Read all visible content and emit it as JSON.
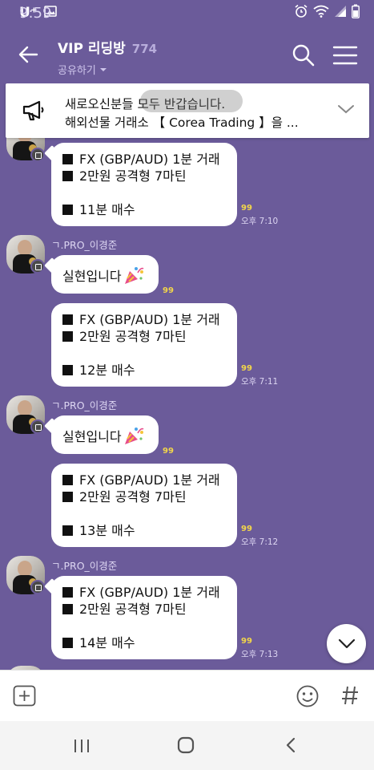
{
  "status_bar": {
    "carrier": "U⁺",
    "time": "9:59",
    "icons": [
      "image-icon",
      "alarm-icon",
      "wifi-icon",
      "signal-icon",
      "battery-icon"
    ]
  },
  "header": {
    "title": "VIP 리딩방",
    "member_count": "774",
    "subtitle": "공유하기",
    "icons": [
      "back-arrow-icon",
      "search-icon",
      "menu-icon"
    ]
  },
  "notice": {
    "line1": "새로오신분들 모두 반갑습니다.",
    "line2": "해외선물 거래소 【 Corea Trading 】을 ..."
  },
  "messages": [
    {
      "sender": "",
      "lines": [
        "FX (GBP/AUD) 1분 거래",
        "2만원 공격형 7마틴",
        "",
        "11분 매수"
      ],
      "read": "99",
      "time": "오후 7:10"
    },
    {
      "sender": "ㄱ.PRO_이경준",
      "text": "실현입니다",
      "read": "99"
    },
    {
      "sender": "",
      "lines": [
        "FX (GBP/AUD) 1분 거래",
        "2만원 공격형 7마틴",
        "",
        "12분 매수"
      ],
      "read": "99",
      "time": "오후 7:11"
    },
    {
      "sender": "ㄱ.PRO_이경준",
      "text": "실현입니다",
      "read": "99"
    },
    {
      "sender": "",
      "lines": [
        "FX (GBP/AUD) 1분 거래",
        "2만원 공격형 7마틴",
        "",
        "13분 매수"
      ],
      "read": "99",
      "time": "오후 7:12"
    },
    {
      "sender": "ㄱ.PRO_이경준",
      "lines": [
        "FX (GBP/AUD) 1분 거래",
        "2만원 공격형 7마틴",
        "",
        "14분 매수"
      ],
      "read": "99",
      "time": "오후 7:13"
    }
  ],
  "input_bar": {
    "icons": [
      "plus-icon",
      "emoji-icon",
      "hashtag-icon"
    ]
  },
  "nav_bar": {
    "icons": [
      "recent-apps-icon",
      "home-icon",
      "back-icon"
    ]
  },
  "colors": {
    "chat_background": "#6b5b9a",
    "bubble": "#ffffff",
    "read_count": "#f2d64a"
  }
}
